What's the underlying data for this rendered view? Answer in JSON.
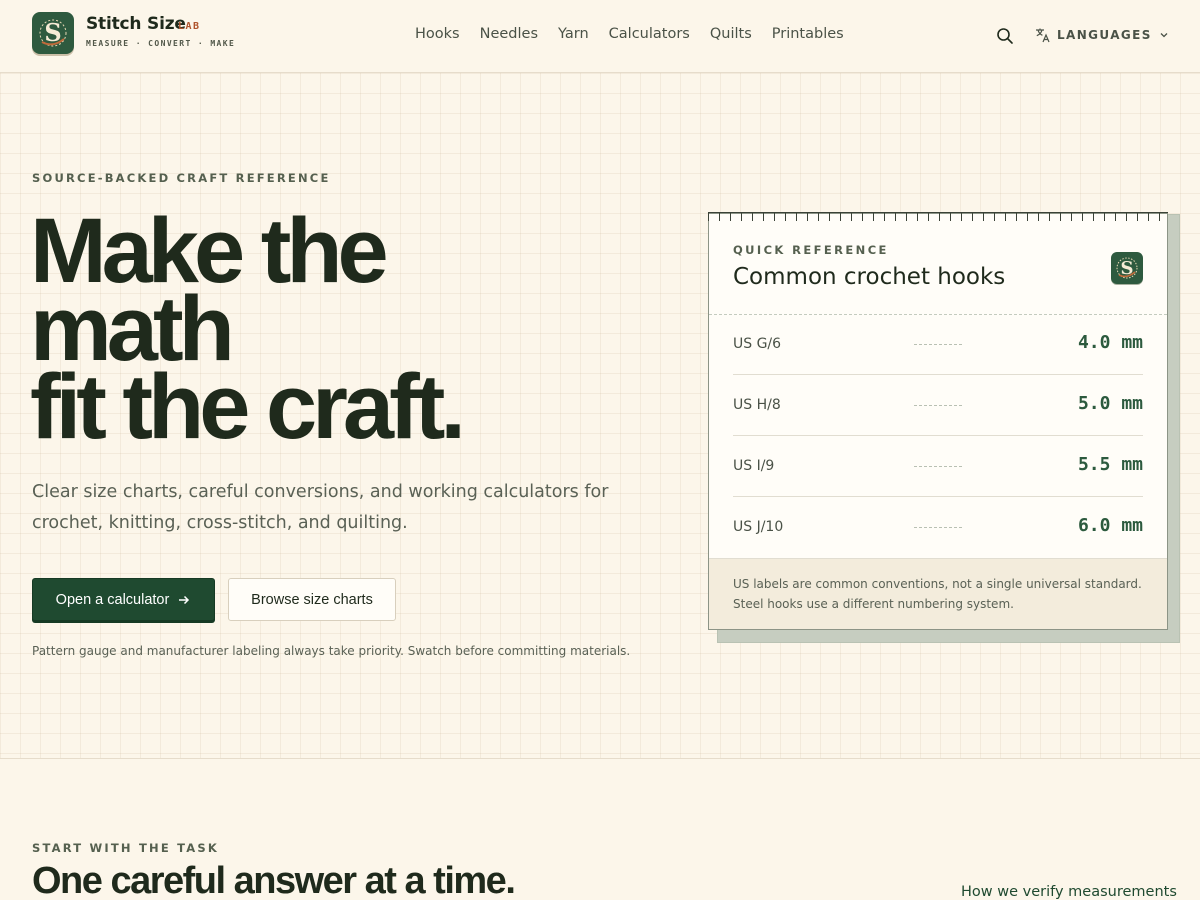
{
  "brand": {
    "name": "Stitch Size",
    "lab": "LAB",
    "tagline": "MEASURE · CONVERT · MAKE",
    "logo_letter": "S"
  },
  "nav": {
    "items": [
      {
        "label": "Hooks"
      },
      {
        "label": "Needles"
      },
      {
        "label": "Yarn"
      },
      {
        "label": "Calculators"
      },
      {
        "label": "Quilts"
      },
      {
        "label": "Printables"
      }
    ],
    "search_icon": "search-icon",
    "languages_label": "LANGUAGES",
    "languages_icon": "translate-icon"
  },
  "hero": {
    "eyebrow": "SOURCE-BACKED CRAFT REFERENCE",
    "headline_lines": [
      "Make the",
      "math",
      "fit the craft."
    ],
    "subtext": "Clear size charts, careful conversions, and working calculators for crochet, knitting, cross-stitch, and quilting.",
    "primary_button": "Open a calculator",
    "secondary_button": "Browse size charts",
    "disclaimer": "Pattern gauge and manufacturer labeling always take priority. Swatch before committing materials."
  },
  "quick_reference": {
    "eyebrow": "QUICK REFERENCE",
    "title": "Common crochet hooks",
    "rows": [
      {
        "label": "US G/6",
        "value": "4.0 mm"
      },
      {
        "label": "US H/8",
        "value": "5.0 mm"
      },
      {
        "label": "US I/9",
        "value": "5.5 mm"
      },
      {
        "label": "US J/10",
        "value": "6.0 mm"
      }
    ],
    "footer": "US labels are common conventions, not a single universal standard. Steel hooks use a different numbering system."
  },
  "section2": {
    "eyebrow": "START WITH THE TASK",
    "title": "One careful answer at a time.",
    "link": "How we verify measurements"
  },
  "colors": {
    "background": "#fcf6ea",
    "brand_green": "#1f4a30",
    "logo_green": "#2e5a3f",
    "accent_rust": "#b0542d",
    "value_green": "#2c5a3e"
  }
}
